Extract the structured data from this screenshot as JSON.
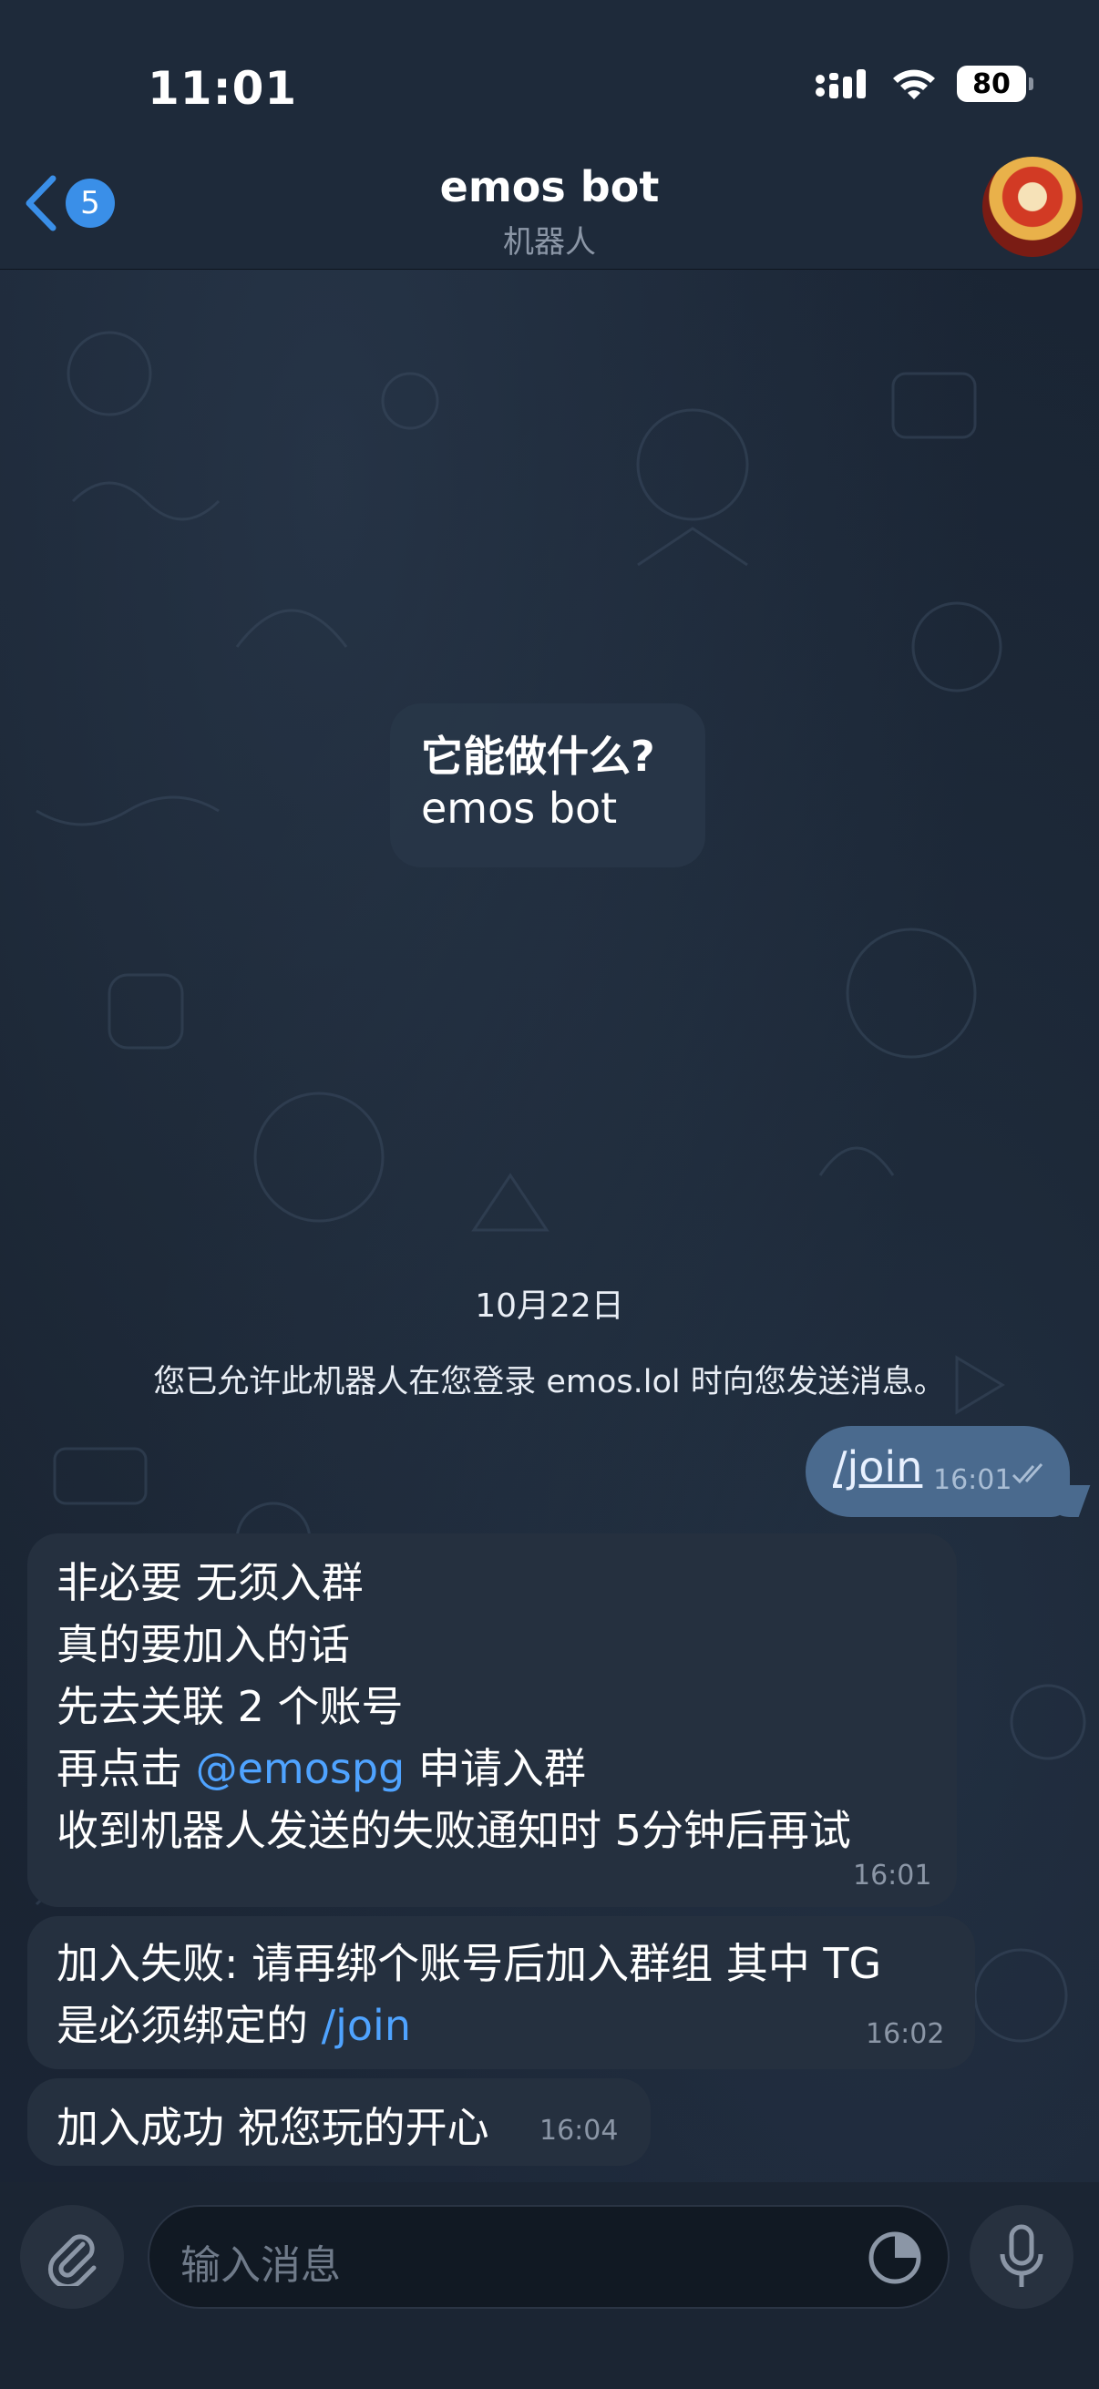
{
  "status_bar": {
    "time": "11:01",
    "battery": "80"
  },
  "header": {
    "back_badge": "5",
    "title": "emos bot",
    "subtitle": "机器人"
  },
  "bot_info": {
    "title": "它能做什么?",
    "subtitle": "emos bot"
  },
  "date_chip": "10月22日",
  "service_message": "您已允许此机器人在您登录 emos.lol 时向您发送消息。",
  "messages": {
    "outgoing_1": {
      "text": "/join",
      "time": "16:01"
    },
    "incoming_1": {
      "lines": [
        "非必要 无须入群",
        "真的要加入的话",
        "先去关联 2 个账号",
        "再点击 ",
        "收到机器人发送的失败通知时 5分钟后再试"
      ],
      "mention": "@emospg",
      "line4_suffix": " 申请入群",
      "time": "16:01"
    },
    "incoming_2": {
      "line1": "加入失败: 请再绑个账号后加入群组 其中 TG",
      "line2": "是必须绑定的 ",
      "command": "/join",
      "time": "16:02"
    },
    "incoming_3": {
      "text": "加入成功 祝您玩的开心",
      "time": "16:04"
    }
  },
  "composer": {
    "placeholder": "输入消息"
  },
  "colors": {
    "accent": "#3a8fe8",
    "mention": "#4fa3ff",
    "outgoing_bubble": "#4a6a8e",
    "incoming_bubble": "#25303f"
  }
}
